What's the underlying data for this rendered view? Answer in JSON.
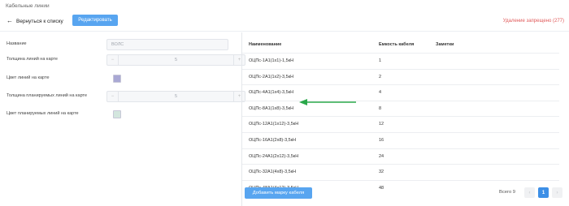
{
  "window": {
    "title": "Кабельные линии"
  },
  "toolbar": {
    "back_label": "Вернуться к списку",
    "edit_label": "Редактировать",
    "delete_status": "Удаление запрещено (277)"
  },
  "form": {
    "name_label": "Название",
    "name_value": "ВОЛС",
    "line_thickness_label": "Толщина линий на карте",
    "line_thickness_value": "5",
    "line_color_label": "Цвет линий на карте",
    "line_color": "#a9a8d4",
    "planned_thickness_label": "Толщина планируемых линий на карте",
    "planned_thickness_value": "5",
    "planned_color_label": "Цвет планируемых линий на карте",
    "planned_color": "#d3e6de",
    "stepper_minus": "−",
    "stepper_plus": "+"
  },
  "table": {
    "headers": [
      "Наименование",
      "Емкость кабеля",
      "Заметки"
    ],
    "rows": [
      {
        "name": "ОЦПс-1А1(1х1)-1,5кН",
        "capacity": "1",
        "notes": ""
      },
      {
        "name": "ОЦПс-2А1(1х2)-3,5кН",
        "capacity": "2",
        "notes": ""
      },
      {
        "name": "ОЦПс-4А1(1х4)-3,5кН",
        "capacity": "4",
        "notes": ""
      },
      {
        "name": "ОЦПс-8А1(1х8)-3,5кН",
        "capacity": "8",
        "notes": ""
      },
      {
        "name": "ОЦПс-12А1(1х12)-3,5кН",
        "capacity": "12",
        "notes": ""
      },
      {
        "name": "ОЦПс-16А1(2х8)-3,5кН",
        "capacity": "16",
        "notes": ""
      },
      {
        "name": "ОЦПс-24А1(2х12)-3,5кН",
        "capacity": "24",
        "notes": ""
      },
      {
        "name": "ОЦПс-32А1(4х8)-3,5кН",
        "capacity": "32",
        "notes": ""
      },
      {
        "name": "ОЦПс-48А1(4х12)-3,5кН",
        "capacity": "48",
        "notes": ""
      }
    ],
    "highlighted_row_index": 3,
    "highlight_color": "#2aa84a"
  },
  "footer": {
    "add_label": "Добавить марку кабеля",
    "total_label": "Всего 9",
    "prev": "‹",
    "current_page": "1",
    "next": "›"
  },
  "colors": {
    "accent": "#58a5f0",
    "danger": "#e05a5a",
    "active_page": "#3d8fe6"
  }
}
